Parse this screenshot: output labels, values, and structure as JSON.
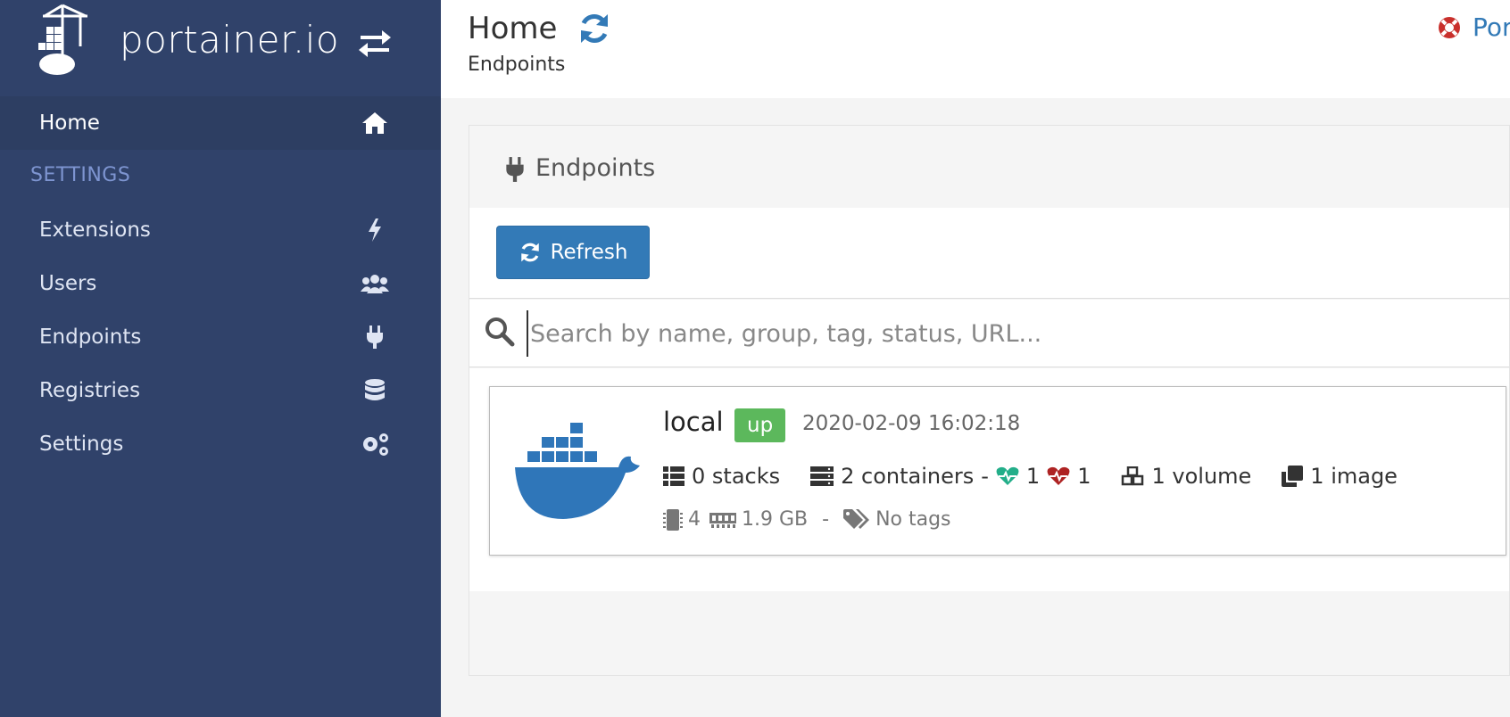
{
  "brand": {
    "logo_text": "portainer.io"
  },
  "sidebar": {
    "home_label": "Home",
    "section_title": "SETTINGS",
    "items": [
      {
        "label": "Extensions",
        "icon": "bolt-icon"
      },
      {
        "label": "Users",
        "icon": "users-icon"
      },
      {
        "label": "Endpoints",
        "icon": "plug-icon"
      },
      {
        "label": "Registries",
        "icon": "database-icon"
      },
      {
        "label": "Settings",
        "icon": "cogs-icon"
      }
    ]
  },
  "header": {
    "title": "Home",
    "breadcrumb": "Endpoints",
    "help_link": "Por"
  },
  "panel": {
    "title": "Endpoints",
    "refresh_label": "Refresh",
    "search_placeholder": "Search by name, group, tag, status, URL..."
  },
  "endpoint": {
    "name": "local",
    "status": "up",
    "timestamp": "2020-02-09 16:02:18",
    "stacks": "0 stacks",
    "containers": "2 containers",
    "healthy_count": "1",
    "unhealthy_count": "1",
    "volumes": "1 volume",
    "images": "1 image",
    "cpu": "4",
    "memory": "1.9 GB",
    "tags": "No tags"
  },
  "colors": {
    "sidebar_bg": "#30426a",
    "section_title": "#7e95d1",
    "primary": "#337ab7",
    "status_up": "#5cb85c",
    "healthy": "#23ae89",
    "unhealthy": "#ae2323"
  }
}
